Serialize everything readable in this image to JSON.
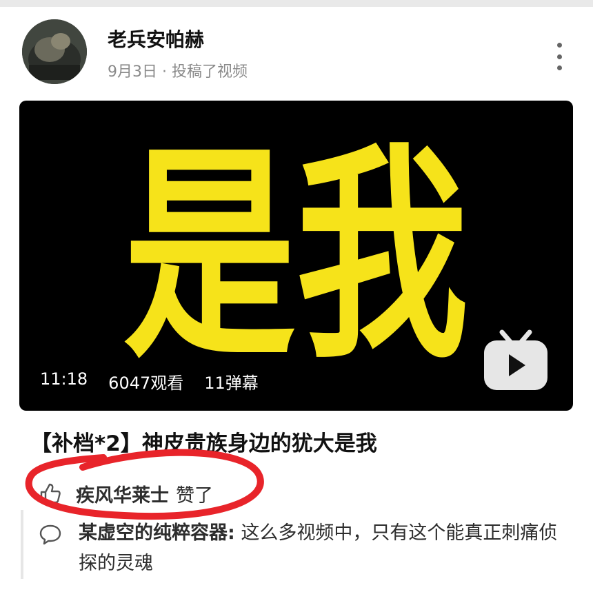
{
  "post": {
    "author": "老兵安帕赫",
    "meta": "9月3日 · 投稿了视频"
  },
  "video": {
    "cover_text": "是我",
    "duration": "11:18",
    "views": "6047观看",
    "danmaku": "11弹幕",
    "title": "【补档*2】神皮贵族身边的犹大是我"
  },
  "like": {
    "user": "疾风华莱士",
    "action": "赞了"
  },
  "comment": {
    "user": "某虚空的纯粹容器:",
    "text": " 这么多视频中，只有这个能真正刺痛侦探的灵魂"
  },
  "colors": {
    "cover_bg": "#000000",
    "cover_text": "#f6e31a",
    "annotation": "#e8242a",
    "meta_text": "#8a8a8a"
  },
  "icons": [
    "more-vertical-icon",
    "bilibili-tv-icon",
    "thumbs-up-icon",
    "comment-icon"
  ]
}
